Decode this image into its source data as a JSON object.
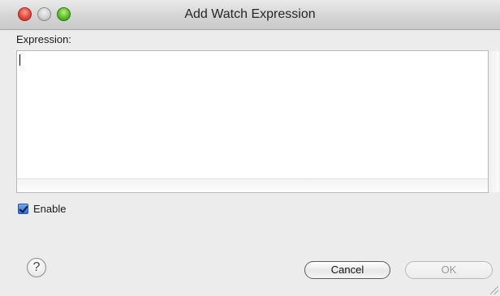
{
  "window": {
    "title": "Add Watch Expression"
  },
  "form": {
    "expression_label": "Expression:",
    "expression_value": "",
    "enable_label": "Enable",
    "enable_checked": true
  },
  "buttons": {
    "help_glyph": "?",
    "cancel_label": "Cancel",
    "ok_label": "OK",
    "ok_enabled": false
  },
  "colors": {
    "close": "#e5463c",
    "minimize": "#cfcfcf",
    "zoom": "#5cbd2c",
    "checkbox": "#2e6fd8"
  },
  "icons": {
    "close": "close-traffic-light-icon",
    "minimize": "minimize-traffic-light-icon",
    "zoom": "zoom-traffic-light-icon",
    "help": "help-icon",
    "check": "checkmark-icon",
    "resize": "resize-grip-icon"
  }
}
